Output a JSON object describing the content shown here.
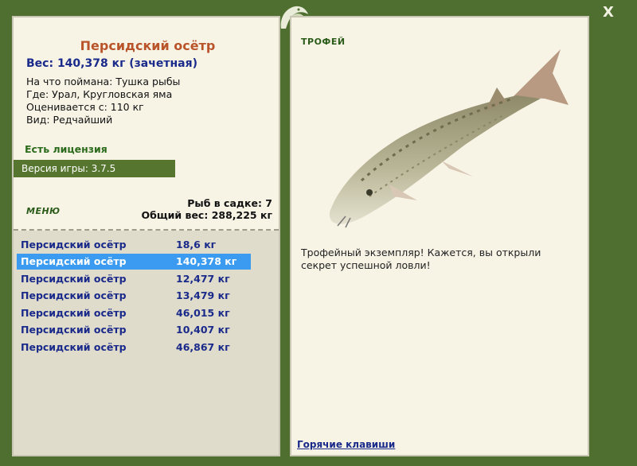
{
  "fish": {
    "title": "Персидский осётр",
    "weight": "Вес: 140,378 кг (зачетная)",
    "caught_on": "На что поймана: Тушка рыбы",
    "where": "Где: Урал, Кругловская яма",
    "rated_from": "Оценивается с: 110 кг",
    "kind": "Вид: Редчайший"
  },
  "license": "Есть лицензия",
  "version": "Версия игры: 3.7.5",
  "menu_label": "МЕНЮ",
  "stats": {
    "fish_count": "Рыб в садке: 7",
    "total_weight": "Общий вес: 288,225 кг"
  },
  "catch_list": [
    {
      "name": "Персидский осётр",
      "kg": "18,6 кг",
      "selected": false
    },
    {
      "name": "Персидский осётр",
      "kg": "140,378 кг",
      "selected": true
    },
    {
      "name": "Персидский осётр",
      "kg": "12,477 кг",
      "selected": false
    },
    {
      "name": "Персидский осётр",
      "kg": "13,479 кг",
      "selected": false
    },
    {
      "name": "Персидский осётр",
      "kg": "46,015 кг",
      "selected": false
    },
    {
      "name": "Персидский осётр",
      "kg": "10,407 кг",
      "selected": false
    },
    {
      "name": "Персидский осётр",
      "kg": "46,867 кг",
      "selected": false
    }
  ],
  "trophy": {
    "label": "ТРОФЕЙ",
    "text": "Трофейный экземпляр! Кажется, вы открыли секрет успешной ловли!"
  },
  "hotkeys_link": "Горячие клавиши",
  "close_label": "X",
  "icons": {
    "close": "close-icon",
    "logo": "fish-logo-icon"
  },
  "colors": {
    "frame": "#4f6f30",
    "panel": "#f7f4e6",
    "list_bg": "#e0dccb",
    "selected": "#3a9bf0",
    "title": "#b9542a",
    "link": "#1a2a8a"
  }
}
